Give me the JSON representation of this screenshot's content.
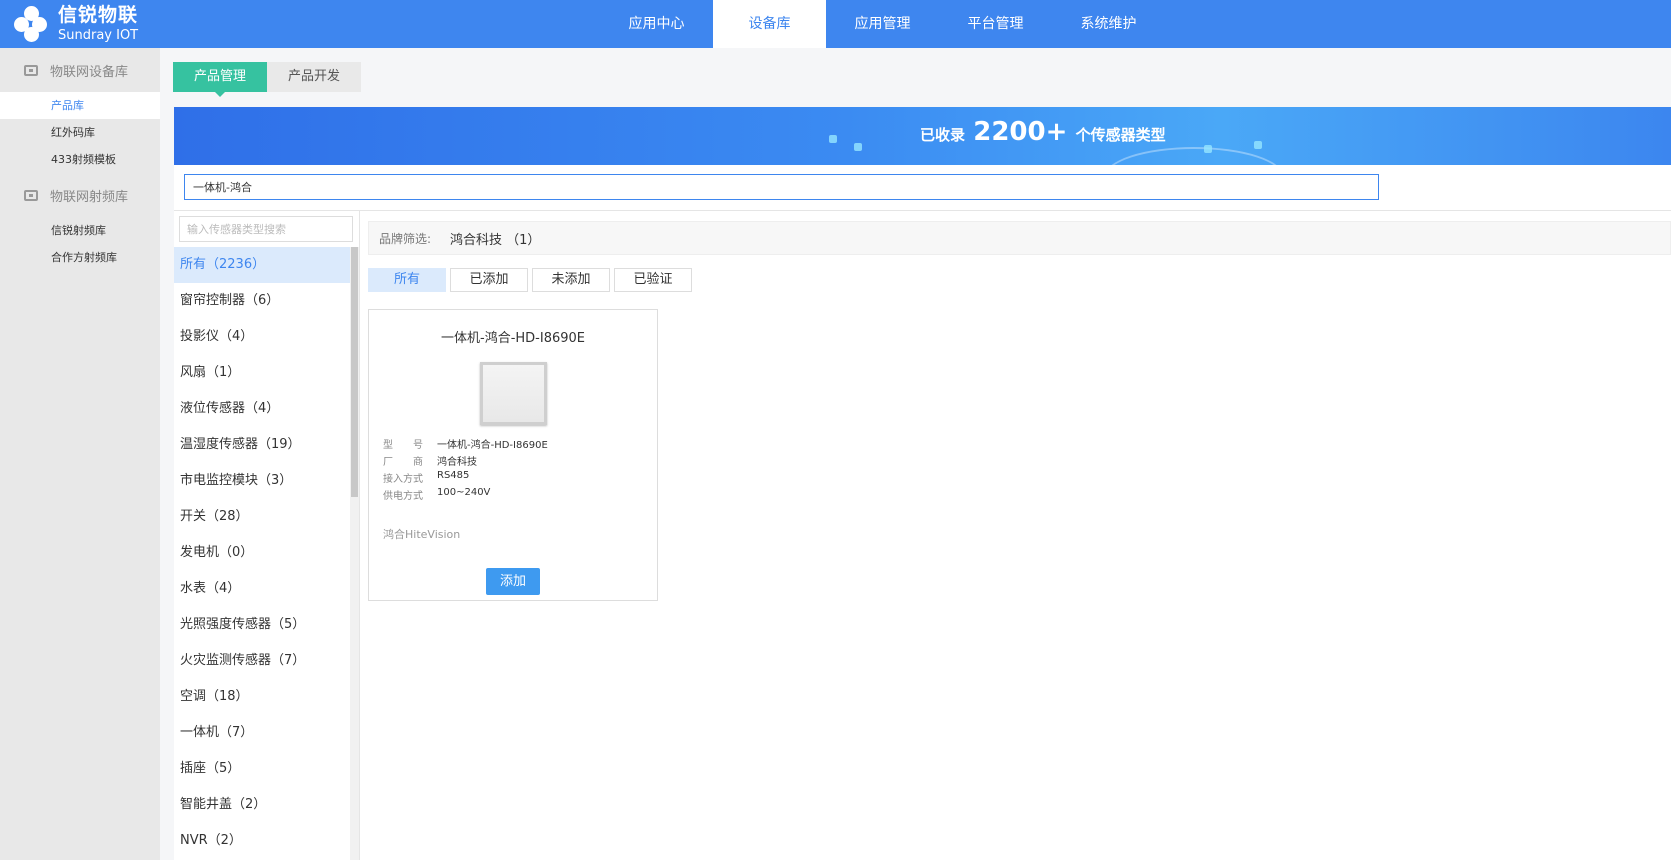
{
  "header": {
    "logo_cn": "信锐物联",
    "logo_en": "Sundray IOT",
    "nav": [
      "应用中心",
      "设备库",
      "应用管理",
      "平台管理",
      "系统维护"
    ],
    "nav_active": "设备库"
  },
  "sidebar": {
    "groups": [
      {
        "label": "物联网设备库",
        "items": [
          "产品库",
          "红外码库",
          "433射频模板"
        ]
      },
      {
        "label": "物联网射频库",
        "items": [
          "信锐射频库",
          "合作方射频库"
        ]
      }
    ],
    "active_item": "产品库"
  },
  "tabs": [
    "产品管理",
    "产品开发"
  ],
  "banner": {
    "prefix": "已收录",
    "count": "2200+",
    "suffix": "个传感器类型"
  },
  "search": {
    "value": "一体机-鸿合"
  },
  "categories": {
    "placeholder": "输入传感器类型搜索",
    "items": [
      "所有（2236）",
      "窗帘控制器（6）",
      "投影仪（4）",
      "风扇（1）",
      "液位传感器（4）",
      "温湿度传感器（19）",
      "市电监控模块（3）",
      "开关（28）",
      "发电机（0）",
      "水表（4）",
      "光照强度传感器（5）",
      "火灾监测传感器（7）",
      "空调（18）",
      "一体机（7）",
      "插座（5）",
      "智能井盖（2）",
      "NVR（2）"
    ]
  },
  "brand_filter": {
    "label": "品牌筛选:",
    "value": "鸿合科技 （1）"
  },
  "status_filters": [
    "所有",
    "已添加",
    "未添加",
    "已验证"
  ],
  "product": {
    "name": "一体机-鸿合-HD-I8690E",
    "specs": [
      {
        "k": "型　　号",
        "v": "一体机-鸿合-HD-I8690E"
      },
      {
        "k": "厂　　商",
        "v": "鸿合科技"
      },
      {
        "k": "接入方式",
        "v": "RS485"
      },
      {
        "k": "供电方式",
        "v": "100~240V"
      }
    ],
    "note": "鸿合HiteVision",
    "button": "添加"
  },
  "colors": {
    "primary": "#3e86ef",
    "tab_active": "#36c2a0"
  }
}
